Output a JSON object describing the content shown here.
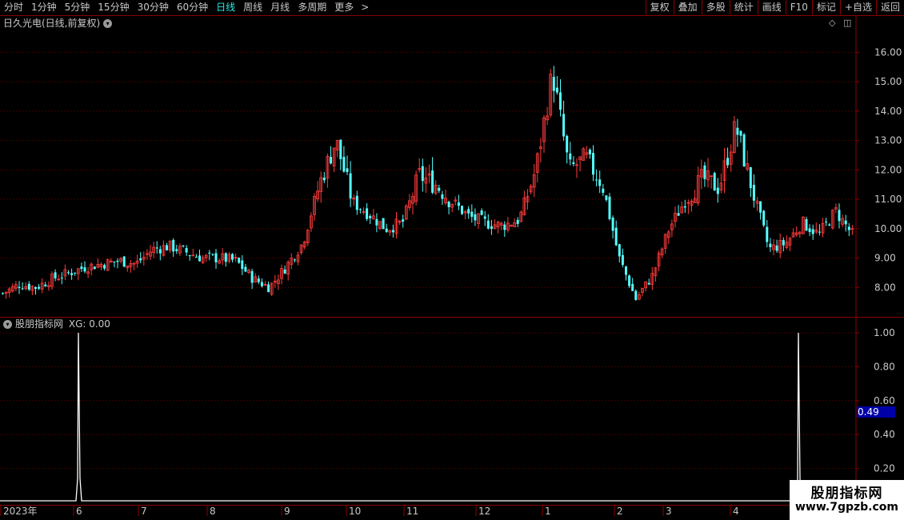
{
  "toolbar": {
    "periods": [
      "分时",
      "1分钟",
      "5分钟",
      "15分钟",
      "30分钟",
      "60分钟",
      "日线",
      "周线",
      "月线",
      "多周期",
      "更多"
    ],
    "active_period": "日线",
    "more_arrow": ">",
    "buttons": [
      "复权",
      "叠加",
      "多股",
      "统计",
      "画线",
      "F10",
      "标记",
      "+自选",
      "返回"
    ]
  },
  "main_chart": {
    "title": "日久光电(日线,前复权)",
    "up_color": "#ff3b3b",
    "down_color": "#54ffff",
    "price_ticks": [
      "16.00",
      "15.00",
      "14.00",
      "13.00",
      "12.00",
      "11.00",
      "10.00",
      "9.00",
      "8.00"
    ],
    "price_range": [
      7.0,
      16.8
    ]
  },
  "indicator": {
    "title": "股朋指标网",
    "value_label": "XG: 0.00",
    "ticks": [
      "1.00",
      "0.80",
      "0.60",
      "0.40",
      "0.20"
    ],
    "current_value": "0.49",
    "signal_color": "#ffffff"
  },
  "time_axis": {
    "labels": [
      "2023年",
      "6",
      "7",
      "8",
      "9",
      "10",
      "11",
      "12",
      "1",
      "2",
      "3",
      "4"
    ]
  },
  "watermark": {
    "name": "股朋指标网",
    "url": "www.7gpzb.com"
  },
  "chart_data": {
    "type": "candlestick",
    "y_range": [
      7.0,
      16.8
    ],
    "x_labels": [
      "2023年",
      "6",
      "7",
      "8",
      "9",
      "10",
      "11",
      "12",
      "1",
      "2",
      "3",
      "4"
    ],
    "price_ticks": [
      16,
      15,
      14,
      13,
      12,
      11,
      10,
      9,
      8
    ],
    "close_path": [
      7.8,
      8.1,
      8.0,
      8.3,
      8.5,
      8.7,
      8.8,
      8.9,
      8.8,
      9.3,
      9.4,
      9.2,
      9.0,
      9.0,
      8.9,
      8.3,
      8.0,
      8.7,
      9.5,
      11.5,
      13.0,
      10.9,
      10.5,
      10.0,
      10.2,
      11.8,
      11.5,
      10.9,
      10.4,
      10.2,
      10.1,
      10.3,
      12.0,
      15.3,
      12.0,
      12.4,
      11.5,
      9.0,
      7.6,
      8.4,
      10.0,
      11.0,
      11.7,
      11.4,
      13.5,
      11.3,
      9.3,
      9.5,
      10.2,
      9.8,
      10.6,
      9.8
    ],
    "indicator_series": {
      "name": "XG",
      "signal_days": [
        "2023-06 (first bar)",
        "2024-04 (last bars)"
      ],
      "range": [
        0,
        1
      ]
    }
  }
}
